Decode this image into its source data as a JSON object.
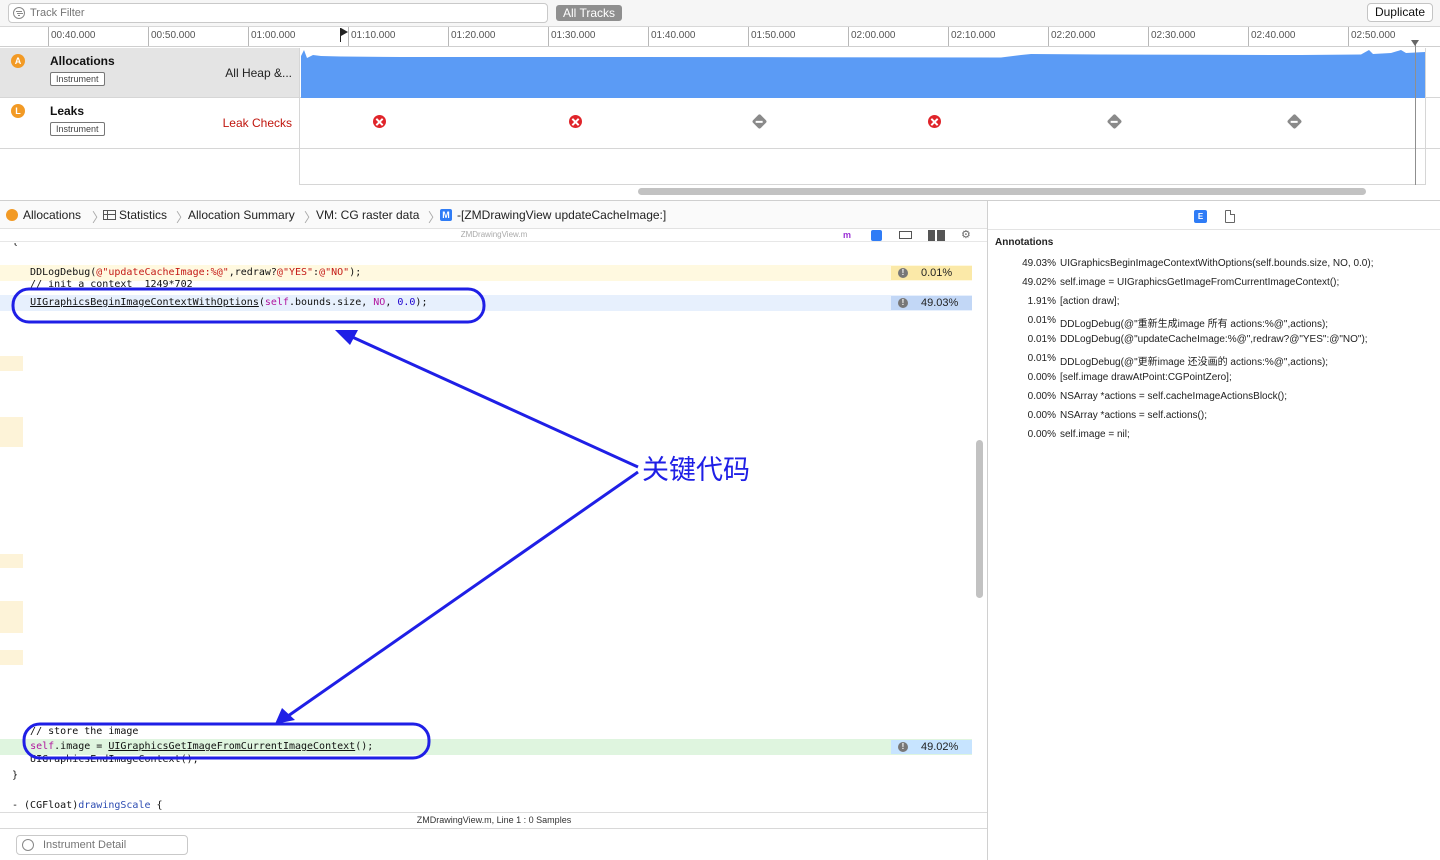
{
  "toolbar": {
    "track_filter_placeholder": "Track Filter",
    "all_tracks_label": "All Tracks",
    "duplicate_label": "Duplicate"
  },
  "ruler": {
    "ticks": [
      "00:40.000",
      "00:50.000",
      "01:00.000",
      "01:10.000",
      "01:20.000",
      "01:30.000",
      "01:40.000",
      "01:50.000",
      "02:00.000",
      "02:10.000",
      "02:20.000",
      "02:30.000",
      "02:40.000",
      "02:50.000"
    ]
  },
  "tracks": {
    "allocations": {
      "name": "Allocations",
      "badge": "Instrument",
      "detail": "All Heap &..."
    },
    "leaks": {
      "name": "Leaks",
      "badge": "Instrument",
      "detail": "Leak Checks"
    },
    "leak_checks": [
      "red",
      "red",
      "grey",
      "red",
      "grey",
      "grey"
    ]
  },
  "colors": {
    "allocation_graph": "#5b9bf5",
    "allocations_row_bg": "#e4e4e4",
    "leak_text": "#c0160e",
    "annotation_overlay": "#1f1fe6",
    "line_yellow": "#fff9e0",
    "line_blue": "#e7f0fd",
    "line_green": "#dff5df",
    "pct_yellow": "#fbe9a8",
    "pct_blue": "#c2d7f6",
    "pct_green": "#c7e4ff"
  },
  "breadcrumb": {
    "items": [
      "Allocations",
      "Statistics",
      "Allocation Summary",
      "VM: CG raster data",
      "-[ZMDrawingView updateCacheImage:]"
    ]
  },
  "editor": {
    "filename": "ZMDrawingView.m",
    "status": "ZMDrawingView.m, Line 1 : 0 Samples",
    "detail_placeholder": "Instrument Detail",
    "pct_1": "0.01%",
    "pct_2": "49.03%",
    "pct_3": "49.02%"
  },
  "annotations": {
    "title": "Annotations",
    "rows": [
      {
        "pct": "49.03%",
        "code": "UIGraphicsBeginImageContextWithOptions(self.bounds.size, NO, 0.0);"
      },
      {
        "pct": "49.02%",
        "code": "self.image = UIGraphicsGetImageFromCurrentImageContext();"
      },
      {
        "pct": "1.91%",
        "code": "[action draw];"
      },
      {
        "pct": "0.01%",
        "code": "DDLogDebug(@\"重新生成image 所有 actions:%@\",actions);"
      },
      {
        "pct": "0.01%",
        "code": "DDLogDebug(@\"updateCacheImage:%@\",redraw?@\"YES\":@\"NO\");"
      },
      {
        "pct": "0.01%",
        "code": "DDLogDebug(@\"更新image  还没画的 actions:%@\",actions);"
      },
      {
        "pct": "0.00%",
        "code": "[self.image drawAtPoint:CGPointZero];"
      },
      {
        "pct": "0.00%",
        "code": "NSArray *actions = self.cacheImageActionsBlock();"
      },
      {
        "pct": "0.00%",
        "code": "NSArray *actions = self.actions();"
      },
      {
        "pct": "0.00%",
        "code": "self.image = nil;"
      }
    ]
  },
  "overlay": {
    "label": "关键代码"
  }
}
